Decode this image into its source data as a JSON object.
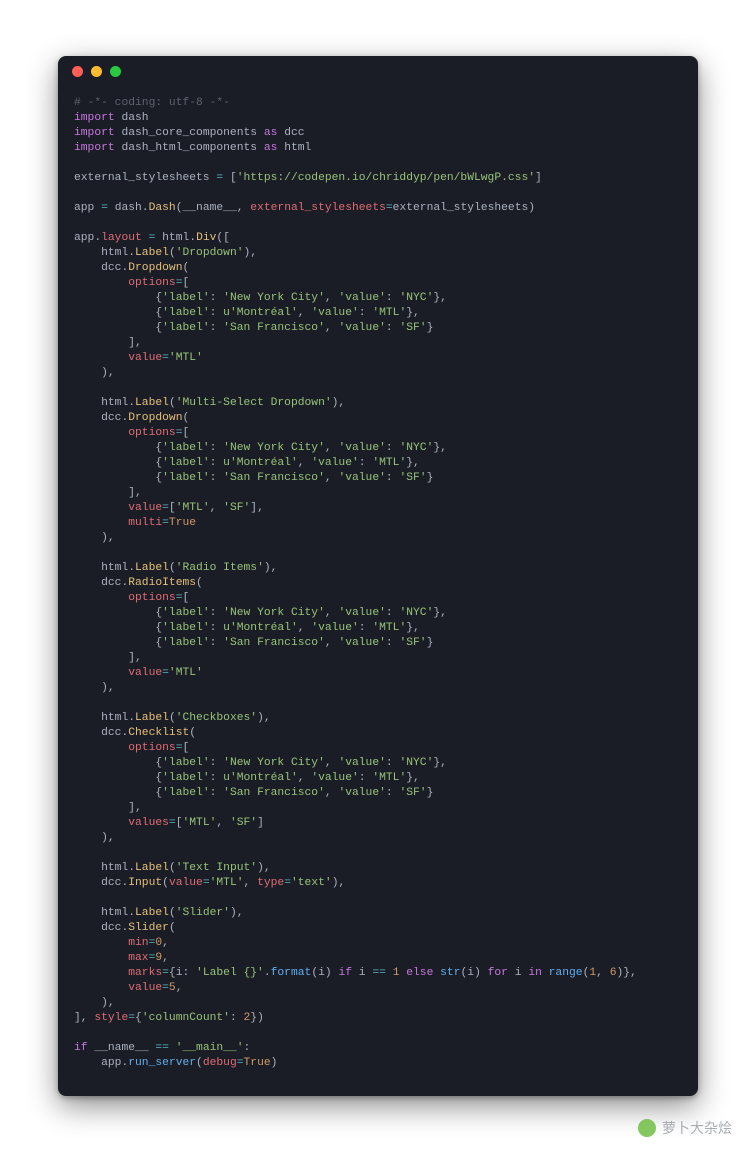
{
  "window": {
    "traffic_lights": [
      "close",
      "minimize",
      "zoom"
    ]
  },
  "code": {
    "language": "python",
    "comment_header": "# -*- coding: utf-8 -*-",
    "imports": [
      {
        "module": "dash"
      },
      {
        "module": "dash_core_components",
        "alias": "dcc"
      },
      {
        "module": "dash_html_components",
        "alias": "html"
      }
    ],
    "external_stylesheets_var": "external_stylesheets",
    "external_stylesheets": [
      "https://codepen.io/chriddyp/pen/bWLwgP.css"
    ],
    "app_assign": {
      "lhs": "app",
      "rhs_module": "dash",
      "rhs_class": "Dash",
      "args": [
        "__name__"
      ],
      "kwargs": {
        "external_stylesheets": "external_stylesheets"
      }
    },
    "layout_assign": "app.layout = html.Div([",
    "sections": [
      {
        "label": "Dropdown",
        "component": "Dropdown",
        "module": "dcc",
        "options": [
          {
            "label": "New York City",
            "prefix": "",
            "value": "NYC"
          },
          {
            "label": "Montréal",
            "prefix": "u",
            "value": "MTL"
          },
          {
            "label": "San Francisco",
            "prefix": "",
            "value": "SF"
          }
        ],
        "kwargs": {
          "value": "'MTL'"
        }
      },
      {
        "label": "Multi-Select Dropdown",
        "component": "Dropdown",
        "module": "dcc",
        "options": [
          {
            "label": "New York City",
            "prefix": "",
            "value": "NYC"
          },
          {
            "label": "Montréal",
            "prefix": "u",
            "value": "MTL"
          },
          {
            "label": "San Francisco",
            "prefix": "",
            "value": "SF"
          }
        ],
        "kwargs": {
          "value": "['MTL', 'SF']",
          "multi": "True"
        }
      },
      {
        "label": "Radio Items",
        "component": "RadioItems",
        "module": "dcc",
        "options": [
          {
            "label": "New York City",
            "prefix": "",
            "value": "NYC"
          },
          {
            "label": "Montréal",
            "prefix": "u",
            "value": "MTL"
          },
          {
            "label": "San Francisco",
            "prefix": "",
            "value": "SF"
          }
        ],
        "kwargs": {
          "value": "'MTL'"
        }
      },
      {
        "label": "Checkboxes",
        "component": "Checklist",
        "module": "dcc",
        "options": [
          {
            "label": "New York City",
            "prefix": "",
            "value": "NYC"
          },
          {
            "label": "Montréal",
            "prefix": "u",
            "value": "MTL"
          },
          {
            "label": "San Francisco",
            "prefix": "",
            "value": "SF"
          }
        ],
        "kwargs": {
          "values": "['MTL', 'SF']"
        }
      },
      {
        "label": "Text Input",
        "component": "Input",
        "module": "dcc",
        "inline_kwargs": {
          "value": "'MTL'",
          "type": "'text'"
        }
      },
      {
        "label": "Slider",
        "component": "Slider",
        "module": "dcc",
        "slider_kwargs": {
          "min": "0",
          "max": "9",
          "marks_expr": "{i: 'Label {}'.format(i) if i == 1 else str(i) for i in range(1, 6)}",
          "value": "5"
        }
      }
    ],
    "layout_close_style": "], style={'columnCount': 2})",
    "main_guard": {
      "condition": "__name__ == '__main__'",
      "body": "app.run_server(debug=True)"
    }
  },
  "watermark": {
    "text": "萝卜大杂烩"
  }
}
